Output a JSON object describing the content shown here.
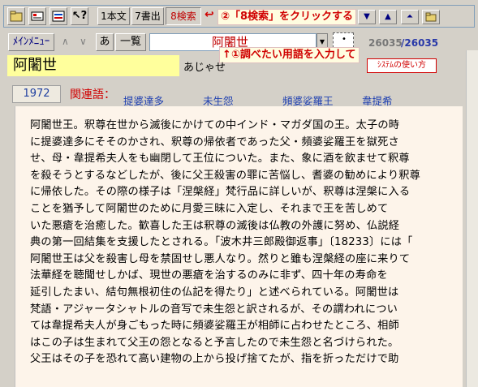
{
  "toolbar": {
    "icons": [
      "open-file-icon",
      "keyboard-icon",
      "settings-icon",
      "help-icon"
    ],
    "buttons": [
      {
        "label": "1本文",
        "pressed": false
      },
      {
        "label": "7書出",
        "pressed": false
      },
      {
        "label": "8検索",
        "pressed": true
      }
    ],
    "nav_icons": [
      "triangle-down-icon",
      "triangle-up-icon",
      "jump-top-icon",
      "folder-icon"
    ]
  },
  "annotations": {
    "step2": "②「8検索」をクリックする",
    "step1": "↑①調べたい用語を入力して"
  },
  "nav": {
    "menu_label": "ﾒｲﾝﾒﾆｭｰ",
    "prev_arrow": "∧",
    "next_arrow": "∨",
    "kana_button": "あ",
    "list_button": "一覧"
  },
  "search": {
    "value": "阿闍世",
    "dropdown_glyph": "▼",
    "current": "26035",
    "total": "/26035"
  },
  "entry": {
    "term": "阿闍世",
    "reading": "あじゃせ",
    "howto_button": "ｼｽﾃﾑの使い方",
    "page": "1972",
    "related_label": "関連語：",
    "related": [
      "提婆達多",
      "未生怨",
      "頻婆娑羅王",
      "韋提希"
    ],
    "lines": [
      "阿闍世王。釈尊在世から滅後にかけての中インド・マガダ国の王。太子の時",
      "に提婆達多にそそのかされ、釈尊の帰依者であった父・頻婆娑羅王を獄死さ",
      "せ、母・韋提希夫人をも幽閉して王位についた。また、象に酒を飲ませて釈尊",
      "を殺そうとするなどしたが、後に父王殺害の罪に苦悩し、耆婆の勧めにより釈尊",
      "に帰依した。その際の様子は「涅槃経」梵行品に詳しいが、釈尊は涅槃に入る",
      "ことを猶予して阿闍世のために月愛三昧に入定し、それまで王を苦しめて",
      "いた悪瘡を治癒した。歓喜した王は釈尊の滅後は仏教の外護に努め、仏説経",
      "典の第一回結集を支援したとされる。「波木井三郎殿御返事」〔18233〕には「",
      "阿闍世王は父を殺害し母を禁固せし悪人なり。然りと雖も涅槃経の座に来りて",
      "法華経を聴聞せしかば、現世の悪瘡を治するのみに非ず、四十年の寿命を",
      "延引したまい、結句無根初住の仏記を得たり」と述べられている。阿闍世は",
      "梵語・アジャータシャトルの音写で未生怨と訳されるが、その謂われについ",
      "ては韋提希夫人が身ごもった時に頻婆娑羅王が相師に占わせたところ、相師",
      "はこの子は生まれて父王の怨となると予言したので未生怨と名づけられた。",
      "父王はその子を恐れて高い建物の上から投げ捨てたが、指を折っただけで助"
    ]
  }
}
